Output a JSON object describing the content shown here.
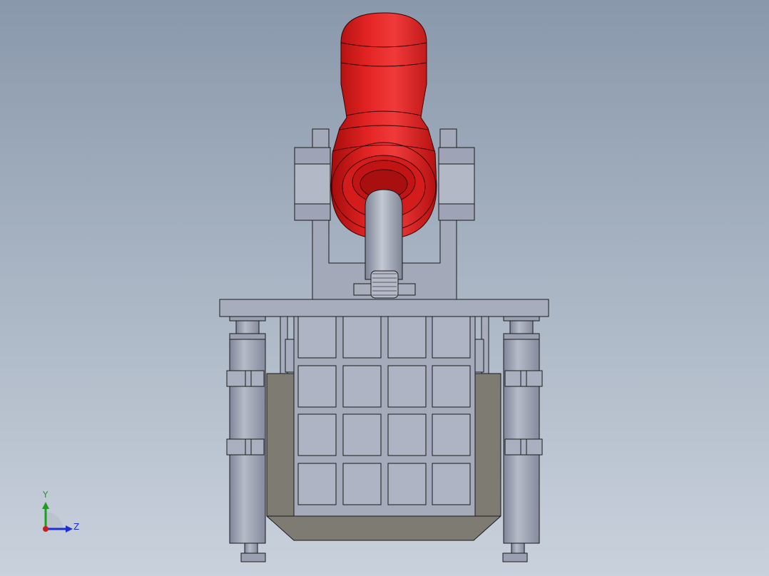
{
  "viewport": {
    "background_top": "#8998ab",
    "background_bottom": "#c9d1dc"
  },
  "model": {
    "cylinder_color": "#dd1a1a",
    "metal_color": "#a3a9b9",
    "liner_color": "#7e7b72",
    "edge_color": "#1a1a1a"
  },
  "triad": {
    "y_label": "Y",
    "z_label": "Z",
    "y_color": "#1d9e1d",
    "z_color": "#1e2fcf",
    "x_color": "#c81e1e"
  }
}
